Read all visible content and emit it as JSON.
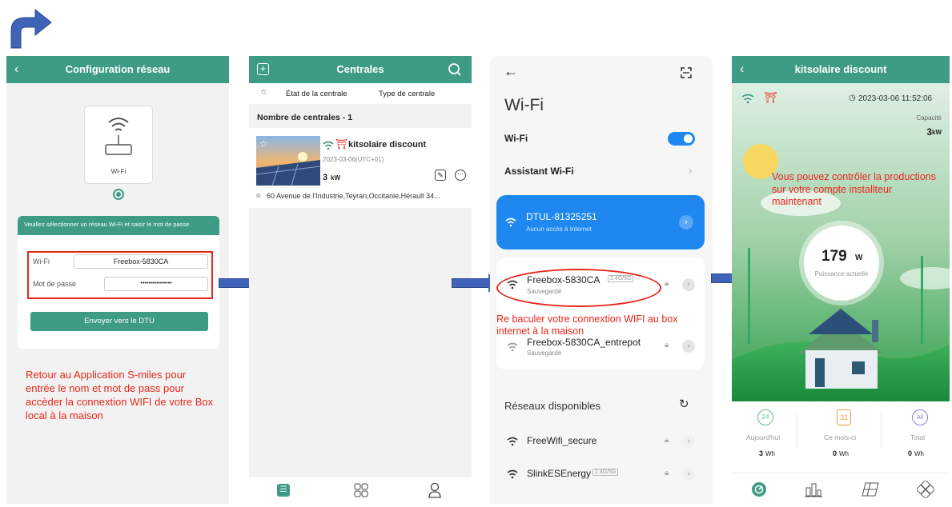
{
  "colors": {
    "teal": "#3e9b86",
    "blue_arrow": "#3f63b8",
    "red": "#e8261b",
    "wifi_blue": "#1e88f0"
  },
  "panel1": {
    "title": "Configuration réseau",
    "device_label": "Wi-Fi",
    "instruction": "Veuillez sélectionner un réseau Wi-Fi et saisir le mot de passe.",
    "wifi_label": "Wi-Fi",
    "wifi_value": "Freebox-5830CA",
    "password_label": "Mot de passe",
    "password_value": "••••••••••••••••",
    "send_button": "Envoyer vers le DTU",
    "annotation": "Retour au Application S-miles pour entrée le nom et mot de pass pour accèder la connextion WIFI de votre Box local à la maison"
  },
  "panel2": {
    "title": "Centrales",
    "filter_state": "État de la centrale",
    "filter_type": "Type de centrale",
    "count": "Nombre de centrales - 1",
    "plant_name": "kitsolaire discount",
    "plant_date": "2023-03-06(UTC+01)",
    "plant_power": "3",
    "plant_unit": "kW",
    "plant_address": "60 Avenue de l'Industrie,Teyran,Occitanie,Hérault 34..."
  },
  "panel3": {
    "title": "Wi-Fi",
    "wifi_toggle_label": "Wi-Fi",
    "assistant_label": "Assistant Wi-Fi",
    "connected_ssid": "DTUL-81325251",
    "connected_status": "Aucun accès à Internet",
    "saved1_ssid": "Freebox-5830CA",
    "saved1_badge": "2.4G/5G",
    "saved1_status": "Sauvegardé",
    "annotation": "Re baculer votre connextion WIFI au box internet à la maison",
    "saved2_ssid": "Freebox-5830CA_entrepot",
    "saved2_status": "Sauvegardé",
    "available_label": "Réseaux disponibles",
    "avail1_ssid": "FreeWifi_secure",
    "avail2_ssid": "SlinkESEnergy",
    "avail2_badge": "2.4G/5G"
  },
  "panel4": {
    "title": "kitsolaire discount",
    "timestamp": "2023-03-06 11:52:06",
    "capacity_label": "Capacité",
    "capacity_value": "3",
    "capacity_unit": "kW",
    "annotation": "Vous pouvez contrôler la productions sur votre compte installteur maintenant",
    "power_value": "179",
    "power_unit": "W",
    "power_label": "Puissance actuelle",
    "stat_today_icon": "24",
    "stat_month_icon": "31",
    "stat_total_icon": "All",
    "stat_today_label": "Aujourd'hui",
    "stat_month_label": "Ce mois-ci",
    "stat_total_label": "Total",
    "stat_today_value": "3",
    "stat_month_value": "0",
    "stat_total_value": "0",
    "stat_unit": "Wh"
  }
}
